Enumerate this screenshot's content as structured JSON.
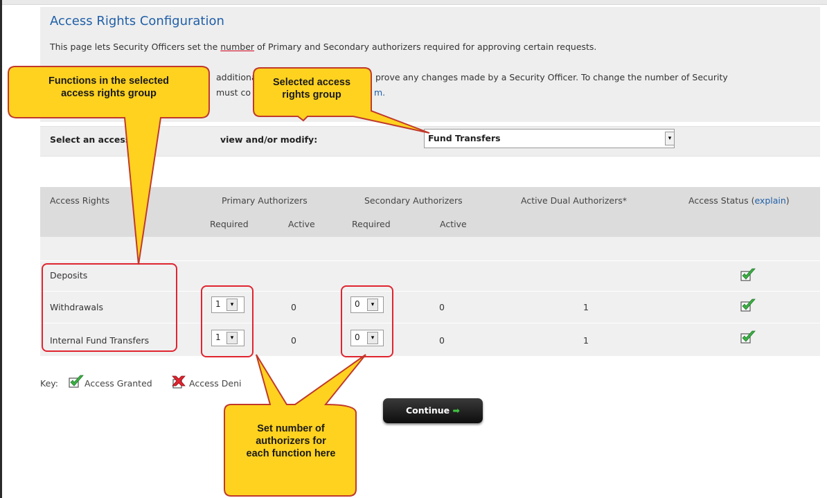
{
  "page": {
    "title": "Access Rights Configuration",
    "intro_line1_pre": "This page lets Security Officers set the ",
    "intro_line1_u": "number",
    "intro_line1_post": " of Primary and Secondary authorizers required for approving certain requests.",
    "intro_line2_left": "additiona",
    "intro_line2_right": "prove any changes made by a Security Officer. To change the number of Security",
    "intro_line3_left": "must co",
    "intro_line3_link": "m."
  },
  "selector": {
    "label_left": "Select an access r",
    "label_right": "view and/or modify:",
    "value": "Fund Transfers",
    "dropdown_glyph": "▾"
  },
  "table": {
    "headers": {
      "access_rights": "Access Rights",
      "primary": "Primary Authorizers",
      "secondary": "Secondary Authorizers",
      "dual": "Active Dual Authorizers*",
      "status": "Access Status (",
      "status_link": "explain",
      "status_close": ")"
    },
    "subheaders": {
      "primary_required": "Required",
      "primary_active": "Active",
      "secondary_required": "Required",
      "secondary_active": "Active"
    },
    "rows": [
      {
        "name": "Deposits",
        "status": "granted"
      },
      {
        "name": "Withdrawals",
        "primary_required": "1",
        "primary_active": "0",
        "secondary_required": "0",
        "secondary_active": "0",
        "dual": "1",
        "status": "granted"
      },
      {
        "name": "Internal Fund Transfers",
        "primary_required": "1",
        "primary_active": "0",
        "secondary_required": "0",
        "secondary_active": "0",
        "dual": "1",
        "status": "granted"
      }
    ]
  },
  "key": {
    "label": "Key:",
    "granted": "Access Granted",
    "denied": "Access Deni"
  },
  "continue_button": {
    "label": "Continue",
    "arrow": "➡"
  },
  "callouts": {
    "functions_line1": "Functions in the selected",
    "functions_line2": "access rights group",
    "selected_line1": "Selected access",
    "selected_line2": "rights group",
    "set_line1": "Set number of",
    "set_line2": "authorizers for",
    "set_line3": "each function here"
  },
  "colors": {
    "title_blue": "#1f5fa8",
    "callout_yellow": "#ffd21f",
    "callout_border": "#c0392b",
    "highlight_red": "#e0242f",
    "granted_green": "#3cb043"
  }
}
